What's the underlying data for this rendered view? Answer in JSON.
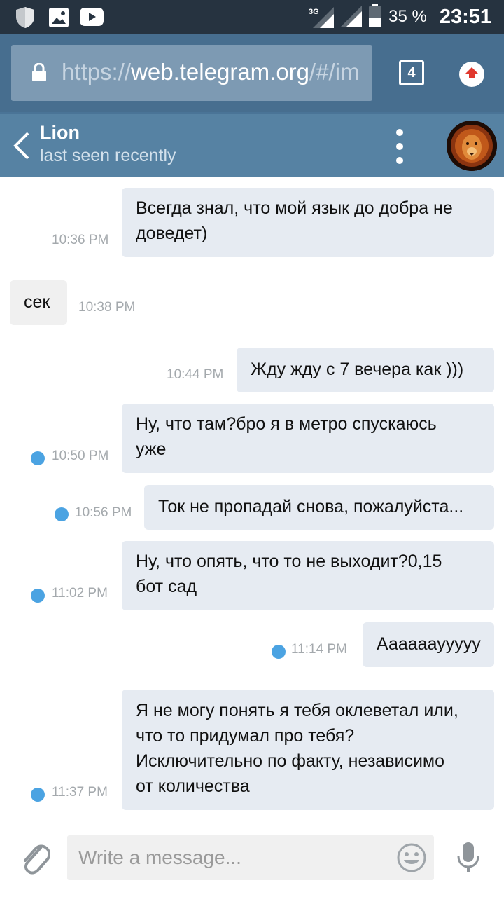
{
  "status_bar": {
    "network": "3G",
    "battery": "35 %",
    "time": "23:51",
    "icons": [
      "shield-icon",
      "image-icon",
      "youtube-icon",
      "signal-3g-icon",
      "signal-icon",
      "battery-icon"
    ]
  },
  "browser": {
    "url_scheme": "https://",
    "url_host": "web.telegram.org",
    "url_rest": "/#/im",
    "tab_count": "4"
  },
  "chat": {
    "peer_name": "Lion",
    "peer_status": "last seen recently"
  },
  "messages": [
    {
      "direction": "out",
      "lines": [
        "Всегда знал, что мой язык до добра не",
        "доведет)"
      ],
      "time": "10:36 PM",
      "unread": false
    },
    {
      "direction": "in",
      "lines": [
        "сек"
      ],
      "time": "10:38 PM",
      "unread": false
    },
    {
      "direction": "out",
      "lines": [
        "Жду жду с  7 вечера как )))"
      ],
      "time": "10:44 PM",
      "unread": false
    },
    {
      "direction": "out",
      "lines": [
        "Ну, что там?бро я в метро спускаюсь",
        "уже"
      ],
      "time": "10:50 PM",
      "unread": true
    },
    {
      "direction": "out",
      "lines": [
        "Ток не пропадай снова, пожалуйста..."
      ],
      "time": "10:56 PM",
      "unread": true
    },
    {
      "direction": "out",
      "lines": [
        "Ну, что опять, что то не выходит?0,15",
        "бот сад"
      ],
      "time": "11:02 PM",
      "unread": true
    },
    {
      "direction": "out",
      "lines": [
        "Ааааааууууу"
      ],
      "time": "11:14 PM",
      "unread": true
    },
    {
      "direction": "out",
      "lines": [
        "Я не могу понять я тебя оклеветал или,",
        "что то придумал про тебя?",
        "Исключительно по факту, независимо",
        "от количества"
      ],
      "time": "11:37 PM",
      "unread": true
    }
  ],
  "composer": {
    "placeholder": "Write a message..."
  },
  "colors": {
    "status_bar_bg": "#263340",
    "browser_bar_bg": "#476e8f",
    "header_bg": "#5682a3",
    "bubble_out": "#e6ebf2",
    "bubble_in": "#f0f0f0",
    "unread_dot": "#4ba3e2",
    "update_arrow": "#e0382d"
  }
}
